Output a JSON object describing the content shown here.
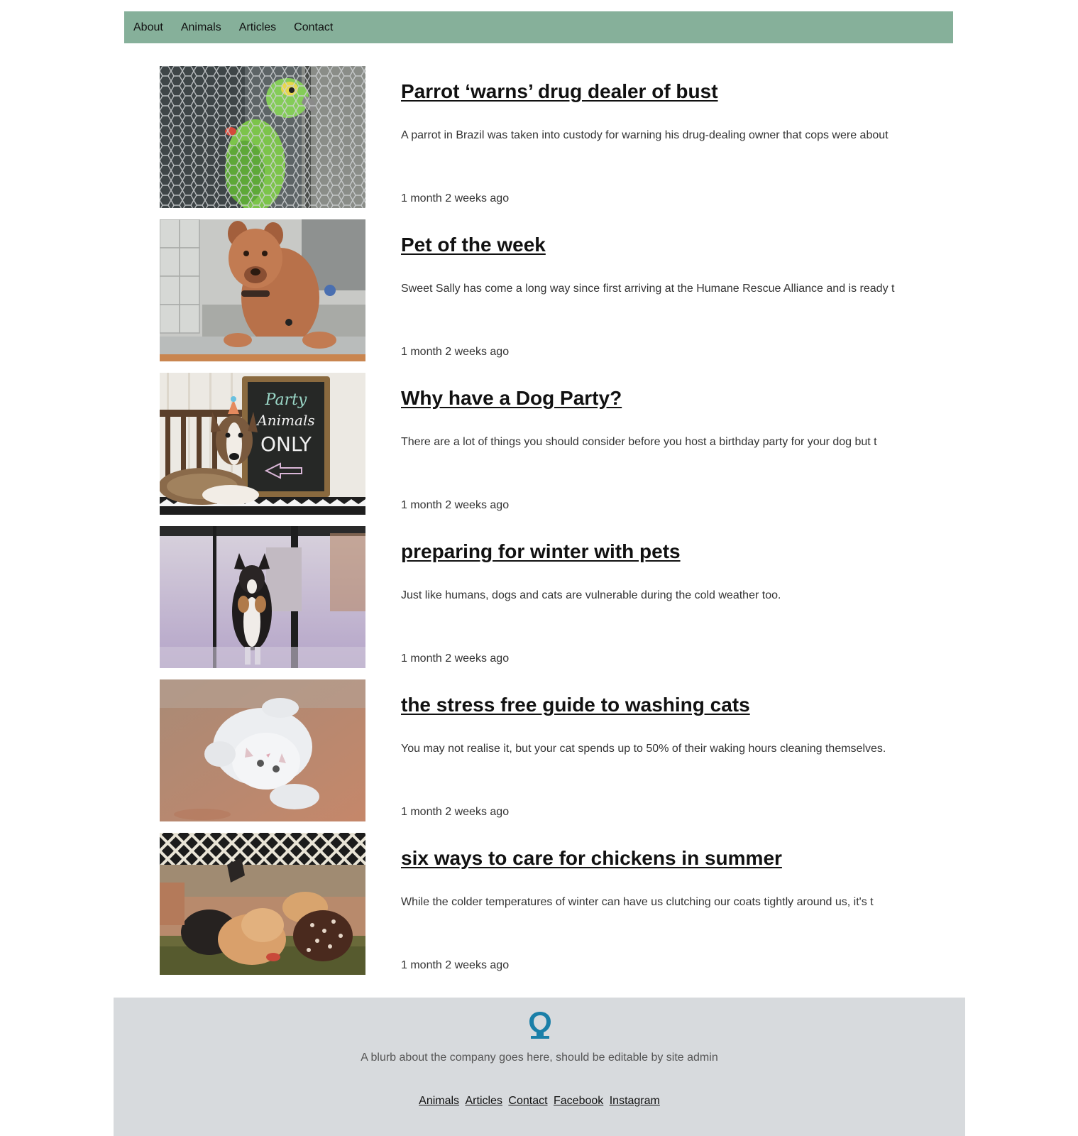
{
  "nav": {
    "items": [
      {
        "label": "About"
      },
      {
        "label": "Animals"
      },
      {
        "label": "Articles"
      },
      {
        "label": "Contact"
      }
    ]
  },
  "articles": [
    {
      "title": "Parrot ‘warns’ drug dealer of bust",
      "summary": "A parrot in Brazil was taken into custody for warning his drug-dealing owner that cops were about",
      "date": "1 month 2 weeks ago"
    },
    {
      "title": "Pet of the week",
      "summary": "Sweet Sally has come a long way since first arriving at the Humane Rescue Alliance and is ready t",
      "date": "1 month 2 weeks ago"
    },
    {
      "title": "Why have a Dog Party?",
      "summary": "There are a lot of things you should consider before you host a birthday party for your dog but t",
      "date": "1 month 2 weeks ago",
      "sign_text": [
        "Party",
        "Animals",
        "ONLY"
      ]
    },
    {
      "title": "preparing for winter with pets",
      "summary": "Just like humans, dogs and cats are vulnerable during the cold weather too.",
      "date": "1 month 2 weeks ago"
    },
    {
      "title": "the stress free guide to washing cats",
      "summary": "You may not realise it, but your cat spends up to 50% of their waking hours cleaning themselves.",
      "date": "1 month 2 weeks ago"
    },
    {
      "title": "six ways to care for chickens in summer",
      "summary": "While the colder temperatures of winter can have us clutching our coats tightly around us, it's t",
      "date": "1 month 2 weeks ago"
    }
  ],
  "footer": {
    "logo_icon": "omega-icon",
    "logo_color": "#1a7fa8",
    "blurb": "A blurb about the company goes here, should be editable by site admin",
    "links": [
      {
        "label": "Animals"
      },
      {
        "label": "Articles"
      },
      {
        "label": "Contact"
      },
      {
        "label": "Facebook"
      },
      {
        "label": "Instagram"
      }
    ]
  },
  "colors": {
    "nav_bg": "#86b09a",
    "footer_bg": "#d7dadd"
  }
}
